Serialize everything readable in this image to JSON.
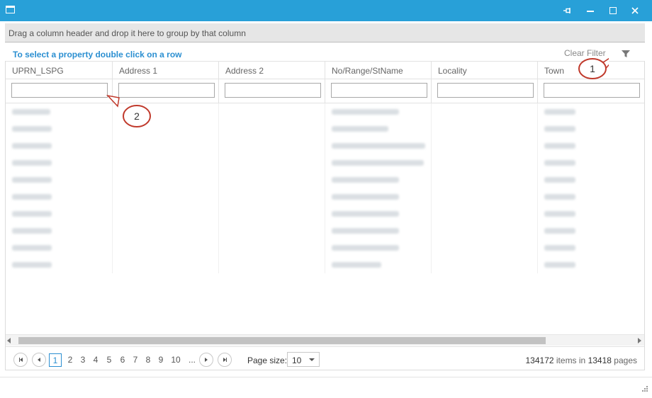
{
  "window": {
    "icon": "window-icon",
    "buttons": [
      "pin-icon",
      "minimize-icon",
      "maximize-icon",
      "close-icon"
    ]
  },
  "group_panel": {
    "text": "Drag a column header and drop it here to group by that column"
  },
  "toolbar": {
    "hint": "To select a property double click on a row",
    "clear_filter": "Clear Filter",
    "filter_icon": "funnel-icon"
  },
  "grid": {
    "columns": [
      {
        "label": "UPRN_LSPG"
      },
      {
        "label": "Address 1"
      },
      {
        "label": "Address 2"
      },
      {
        "label": "No/Range/StName"
      },
      {
        "label": "Locality"
      },
      {
        "label": "Town"
      }
    ],
    "rows_obscured": true
  },
  "pager": {
    "pages": [
      "1",
      "2",
      "3",
      "4",
      "5",
      "6",
      "7",
      "8",
      "9",
      "10",
      "..."
    ],
    "current_page": "1",
    "page_size_label": "Page size:",
    "page_size": "10",
    "items_count": "134172",
    "items_word": "items in",
    "pages_count": "13418",
    "pages_word": "pages"
  },
  "callouts": [
    {
      "label": "1"
    },
    {
      "label": "2"
    }
  ],
  "colors": {
    "titlebar": "#28a0d8",
    "hint": "#2b8fd1",
    "callout_stroke": "#c0392b"
  }
}
